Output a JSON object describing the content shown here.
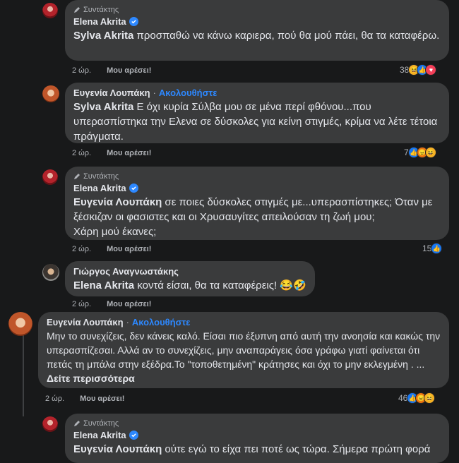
{
  "common": {
    "author_badge": "Συντάκτης",
    "like": "Μου αρέσει!",
    "follow": "Ακολουθήστε",
    "dot": "·"
  },
  "comments": [
    {
      "name": "Elena Akrita",
      "tag": "Sylva Akrita",
      "text": " προσπαθώ να κάνω καριερα, πού θα μού πάει, θα τα καταφέρω.",
      "time": "2 ώρ.",
      "count": "38",
      "reactions": [
        "haha",
        "like",
        "love"
      ]
    },
    {
      "name": "Ευγενία Λουπάκη",
      "tag": "Sylva Akrita",
      "text": " Ε όχι κυρία Σύλβα μου σε μένα περί φθόνου...που υπερασπίστηκα την Ελενα σε δύσκολες για κείνη στιγμές, κρίμα να λέτε τέτοια πράγματα.",
      "time": "2 ώρ.",
      "count": "7",
      "reactions": [
        "like",
        "angry",
        "haha"
      ]
    },
    {
      "name": "Elena Akrita",
      "tag": "Ευγενία Λουπάκη",
      "text": " σε ποιες δύσκολες στιγμές με...υπερασπίστηκες; Όταν με ξέσκιζαν οι φασιστες και οι Χρυσαυγίτες απειλούσαν τη ζωή μου;",
      "text2": "Χάρη μού έκανες;",
      "time": "2 ώρ.",
      "count": "15",
      "reactions": [
        "like"
      ]
    },
    {
      "name": "Γιώργος Αναγνωστάκης",
      "tag": "Elena Akrita",
      "text": " κοντά είσαι, θα τα καταφέρεις! 😂🤣",
      "time": "2 ώρ.",
      "count": "",
      "reactions": []
    },
    {
      "name": "Ευγενία Λουπάκη",
      "text": "Μην το συνεχίζεις, δεν κάνεις καλό. Είσαι πιο έξυπνη από αυτή την ανοησία και κακώς την υπερασπίζεσαι. Αλλά αν το συνεχίζεις, μην αναπαράγεις όσα γράφω γιατί φαίνεται ότι πετάς τη μπάλα στην εξέδρα.Το \"τοποθετημένη\" κράτησες και όχι το μην εκλεγμένη . ... ",
      "see_more": "Δείτε περισσότερα",
      "time": "2 ώρ.",
      "count": "46",
      "reactions": [
        "like",
        "angry",
        "haha"
      ]
    },
    {
      "name": "Elena Akrita",
      "tag": "Ευγενία Λουπάκη",
      "text": " ούτε εγώ το είχα πει ποτέ ως τώρα. Σήμερα πρώτη φορά"
    }
  ],
  "colors": {
    "bg": "#18191a",
    "bubble": "#3a3b3c",
    "link": "#2d88ff",
    "muted": "#b0b3b8"
  }
}
